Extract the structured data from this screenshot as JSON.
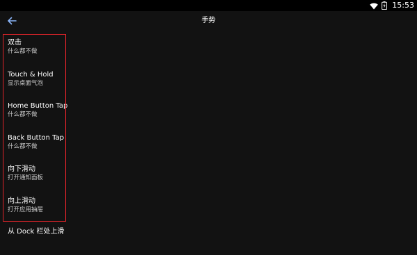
{
  "status_bar": {
    "time": "15:53",
    "icons": [
      "wifi-icon",
      "battery-icon"
    ]
  },
  "toolbar": {
    "title": "手势",
    "back_icon": "arrow-left-icon"
  },
  "items": [
    {
      "title": "双击",
      "summary": "什么都不做"
    },
    {
      "title": "Touch & Hold",
      "summary": "显示桌面气泡"
    },
    {
      "title": "Home Button Tap",
      "summary": "什么都不做"
    },
    {
      "title": "Back Button Tap",
      "summary": "什么都不做"
    },
    {
      "title": "向下滑动",
      "summary": "打开通知面板"
    },
    {
      "title": "向上滑动",
      "summary": "打开应用抽屉"
    },
    {
      "title": "从 Dock 栏处上滑",
      "summary": ""
    }
  ],
  "colors": {
    "background": "#121212",
    "accent": "#8ab4f8",
    "highlight": "#e0242a"
  }
}
